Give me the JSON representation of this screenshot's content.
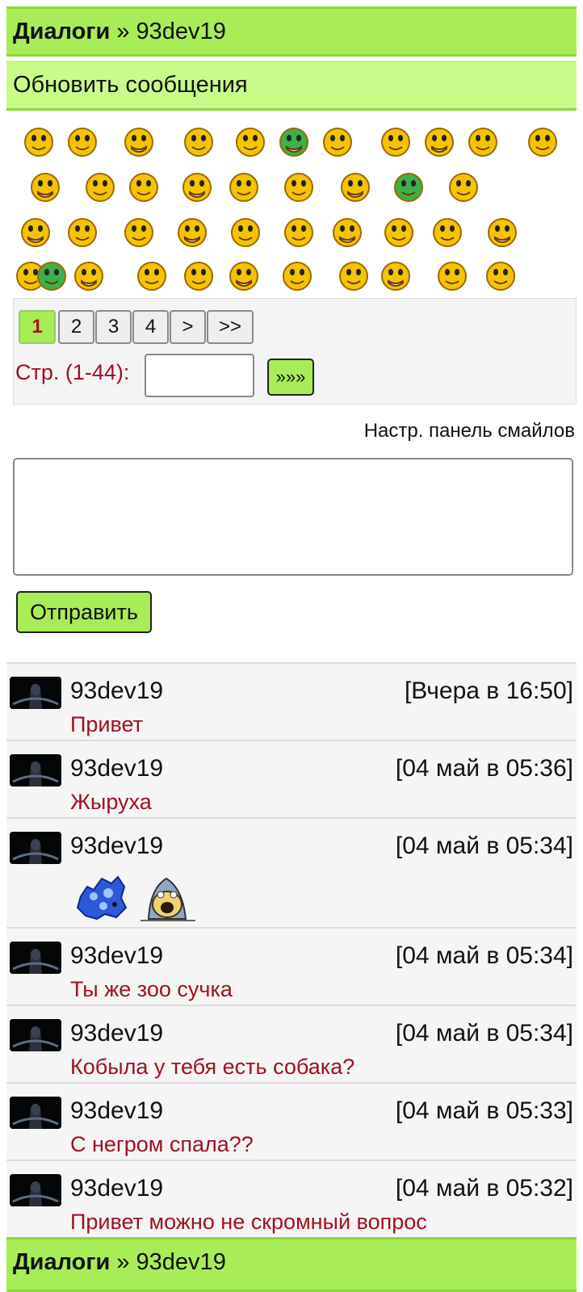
{
  "header": {
    "title": "Диалоги",
    "separator": "»",
    "user": "93dev19"
  },
  "refresh_label": "Обновить сообщения",
  "pager": {
    "pages": [
      "1",
      "2",
      "3",
      "4",
      ">",
      ">>"
    ],
    "label": "Стр. (1-44):",
    "input_value": "",
    "go_label": "»»»"
  },
  "smiley_settings_label": "Настр. панель смайлов",
  "message_input": {
    "value": ""
  },
  "send_label": "Отправить",
  "messages": [
    {
      "user": "93dev19",
      "time": "[Вчера в 16:50]",
      "text": "Привет"
    },
    {
      "user": "93dev19",
      "time": "[04 май в 05:36]",
      "text": "Жыруха"
    },
    {
      "user": "93dev19",
      "time": "[04 май в 05:34]",
      "text": "",
      "pictures": [
        "blue-dog-smiley",
        "dog-face-smiley"
      ]
    },
    {
      "user": "93dev19",
      "time": "[04 май в 05:34]",
      "text": "Ты же зоо сучка"
    },
    {
      "user": "93dev19",
      "time": "[04 май в 05:34]",
      "text": "Кобыла у тебя есть собака?"
    },
    {
      "user": "93dev19",
      "time": "[04 май в 05:33]",
      "text": "С негром спала??"
    },
    {
      "user": "93dev19",
      "time": "[04 май в 05:32]",
      "text": "Привет можно не скромный вопрос"
    }
  ],
  "footer": {
    "title": "Диалоги",
    "separator": "»",
    "user": "93dev19"
  },
  "colors": {
    "accent_green": "#a8ec57",
    "light_green": "#c8fb8a",
    "message_text": "#a01020",
    "smiley_yellow": "#f5c400"
  }
}
